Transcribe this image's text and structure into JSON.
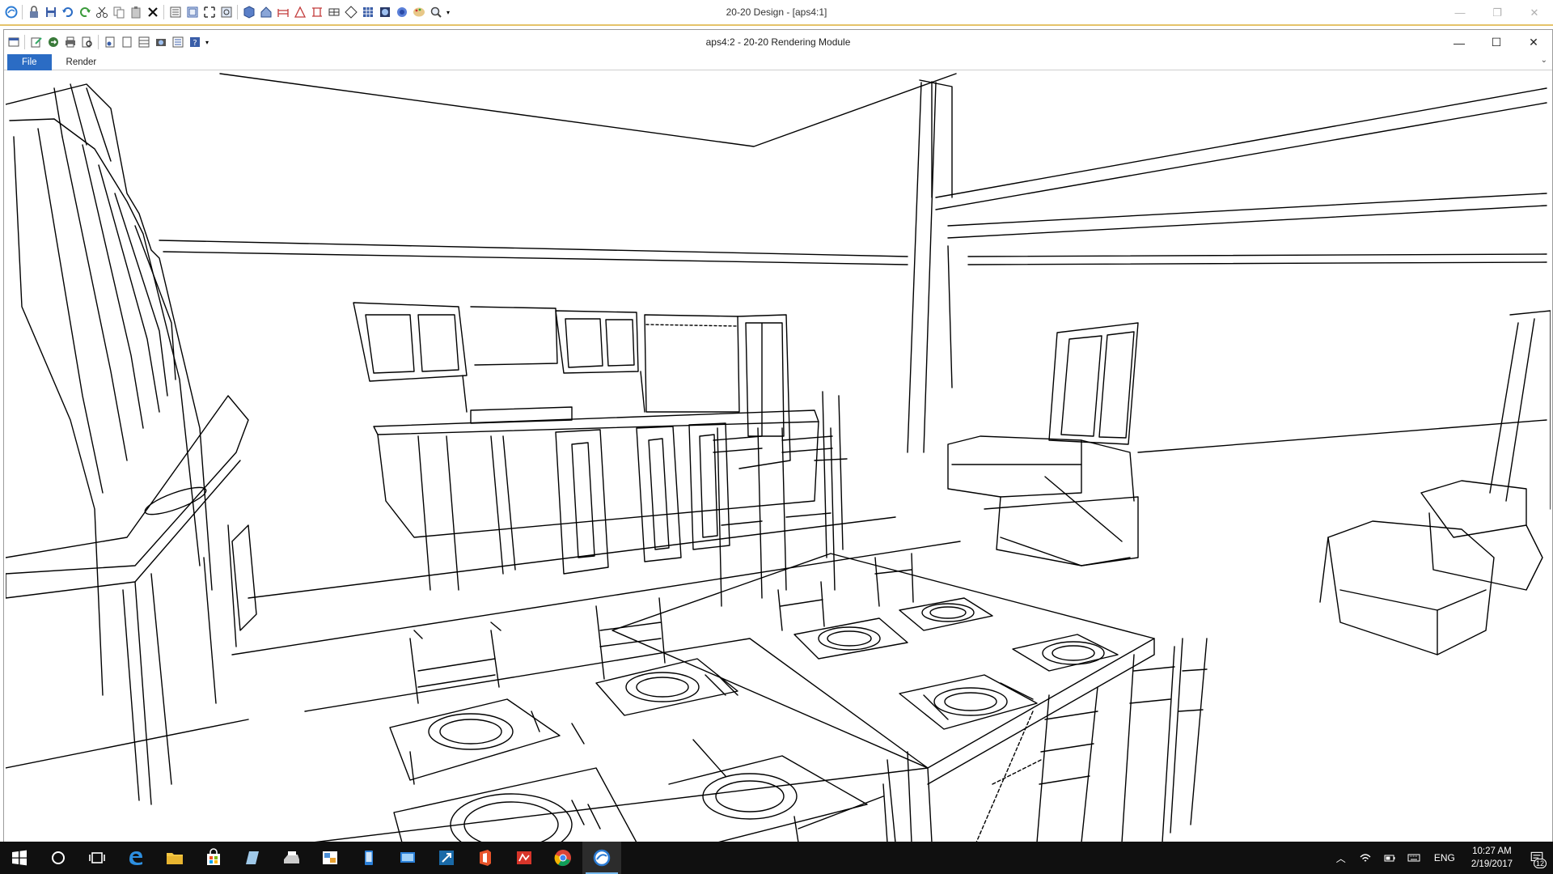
{
  "app": {
    "title": "20-20 Design - [aps4:1]",
    "window_controls": [
      "minimize",
      "restore",
      "close"
    ]
  },
  "quick_access_toolbar": [
    "app-logo-icon",
    "lock-icon",
    "save-icon",
    "undo-icon",
    "redo-icon",
    "cut-icon",
    "copy-icon",
    "paste-icon",
    "delete-icon",
    "catalog-icon",
    "layout-icon",
    "fit-icon",
    "zoom-window-icon",
    "cube-view-icon",
    "house-view-icon",
    "elevation-icon",
    "perspective-icon",
    "plan-icon",
    "dimension-icon",
    "grid-icon",
    "render-icon",
    "sphere-icon",
    "palette-icon",
    "zoom-icon",
    "more-icon"
  ],
  "module": {
    "title": "aps4:2 - 20-20 Rendering Module",
    "toolbar": [
      "window-icon",
      "edit-icon",
      "export-icon",
      "print-icon",
      "print-preview-icon",
      "page-icon",
      "page-setup-icon",
      "copy-image-icon",
      "camera-icon",
      "settings-icon",
      "help-icon",
      "more-icon"
    ],
    "menu": {
      "file": "File",
      "render": "Render"
    }
  },
  "scene": {
    "description_name": "kitchen-dining-rendering"
  },
  "taskbar": {
    "apps": [
      "start-icon",
      "cortana-icon",
      "task-view-icon",
      "edge-icon",
      "file-explorer-icon",
      "store-icon",
      "notepad-icon",
      "print-icon",
      "photos-icon",
      "phone-icon",
      "remote-icon",
      "paint-icon",
      "office-icon",
      "2020-design-icon",
      "chrome-icon",
      "2020-app-icon"
    ],
    "active_app": "2020-app-icon",
    "language": "ENG",
    "time": "10:27 AM",
    "date": "2/19/2017",
    "notification_count": "12"
  }
}
